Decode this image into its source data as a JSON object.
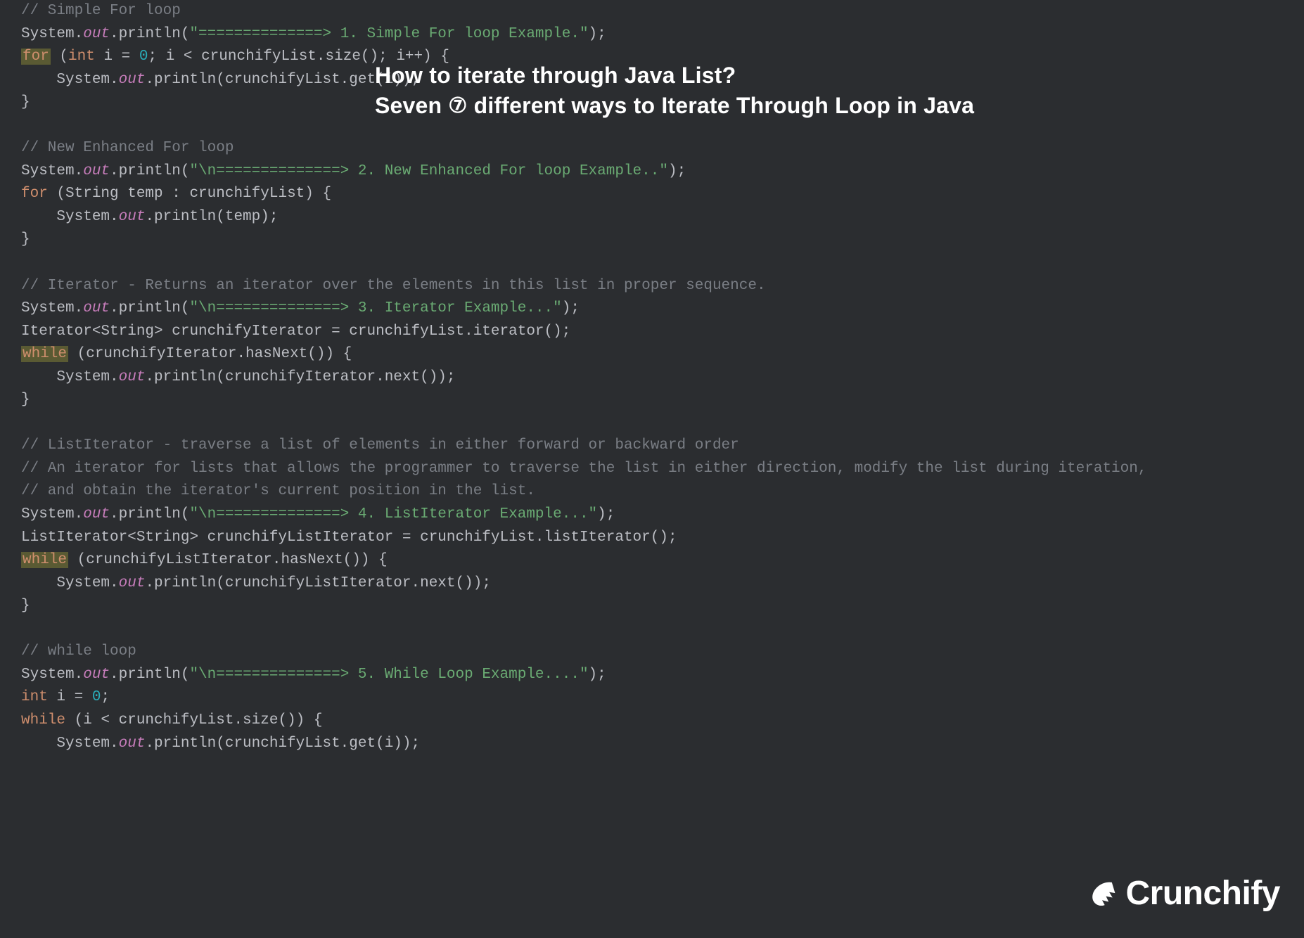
{
  "overlay": {
    "line1": "How to iterate through Java List?",
    "line2_a": "Seven ",
    "line2_circled": "⑦",
    "line2_b": " different ways to Iterate Through Loop in Java"
  },
  "logo": {
    "text": "Crunchify"
  },
  "code": {
    "c1": "// Simple For loop",
    "l2_a": "System.",
    "l2_out": "out",
    "l2_b": ".println(",
    "l2_str": "\"==============> 1. Simple For loop Example.\"",
    "l2_c": ");",
    "l3_for": "for",
    "l3_a": " (",
    "l3_int": "int",
    "l3_b": " i = ",
    "l3_zero": "0",
    "l3_c": "; i < crunchifyList.size(); i++) {",
    "l4_a": "    System.",
    "l4_out": "out",
    "l4_b": ".println(crunchifyList.get(i));",
    "l5": "}",
    "c2": "// New Enhanced For loop",
    "l7_a": "System.",
    "l7_out": "out",
    "l7_b": ".println(",
    "l7_str": "\"\\n==============> 2. New Enhanced For loop Example..\"",
    "l7_c": ");",
    "l8_for": "for",
    "l8_a": " (String temp : crunchifyList) {",
    "l9_a": "    System.",
    "l9_out": "out",
    "l9_b": ".println(temp);",
    "l10": "}",
    "c3": "// Iterator - Returns an iterator over the elements in this list in proper sequence.",
    "l12_a": "System.",
    "l12_out": "out",
    "l12_b": ".println(",
    "l12_str": "\"\\n==============> 3. Iterator Example...\"",
    "l12_c": ");",
    "l13": "Iterator<String> crunchifyIterator = crunchifyList.iterator();",
    "l14_while": "while",
    "l14_a": " (crunchifyIterator.hasNext()) {",
    "l15_a": "    System.",
    "l15_out": "out",
    "l15_b": ".println(crunchifyIterator.next());",
    "l16": "}",
    "c4a": "// ListIterator - traverse a list of elements in either forward or backward order",
    "c4b": "// An iterator for lists that allows the programmer to traverse the list in either direction, modify the list during iteration,",
    "c4c": "// and obtain the iterator's current position in the list.",
    "l20_a": "System.",
    "l20_out": "out",
    "l20_b": ".println(",
    "l20_str": "\"\\n==============> 4. ListIterator Example...\"",
    "l20_c": ");",
    "l21": "ListIterator<String> crunchifyListIterator = crunchifyList.listIterator();",
    "l22_while": "while",
    "l22_a": " (crunchifyListIterator.hasNext()) {",
    "l23_a": "    System.",
    "l23_out": "out",
    "l23_b": ".println(crunchifyListIterator.next());",
    "l24": "}",
    "c5": "// while loop",
    "l26_a": "System.",
    "l26_out": "out",
    "l26_b": ".println(",
    "l26_str": "\"\\n==============> 5. While Loop Example....\"",
    "l26_c": ");",
    "l27_int": "int",
    "l27_a": " i = ",
    "l27_zero": "0",
    "l27_b": ";",
    "l28_while": "while",
    "l28_a": " (i < crunchifyList.size()) {",
    "l29_a": "    System.",
    "l29_out": "out",
    "l29_b": ".println(crunchifyList.get(i));"
  }
}
